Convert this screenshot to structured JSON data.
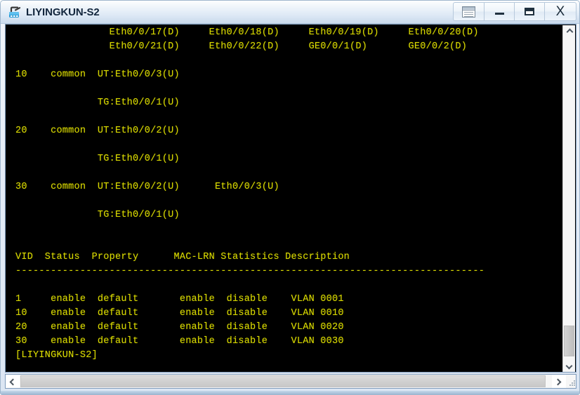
{
  "window": {
    "title": "LIYINGKUN-S2",
    "app_icon": "router-terminal-icon",
    "controls": {
      "restore_doc_label": "",
      "minimize_label": "",
      "maximize_label": "",
      "close_label": "X"
    }
  },
  "terminal": {
    "foreground_color": "#d7d700",
    "background_color": "#000000",
    "lines": [
      "                Eth0/0/17(D)     Eth0/0/18(D)     Eth0/0/19(D)     Eth0/0/20(D)",
      "                Eth0/0/21(D)     Eth0/0/22(D)     GE0/0/1(D)       GE0/0/2(D)",
      "",
      "10    common  UT:Eth0/0/3(U)",
      "",
      "              TG:Eth0/0/1(U)",
      "",
      "20    common  UT:Eth0/0/2(U)",
      "",
      "              TG:Eth0/0/1(U)",
      "",
      "30    common  UT:Eth0/0/2(U)      Eth0/0/3(U)",
      "",
      "              TG:Eth0/0/1(U)",
      "",
      "",
      "VID  Status  Property      MAC-LRN Statistics Description",
      "--------------------------------------------------------------------------------",
      "",
      "1     enable  default       enable  disable    VLAN 0001",
      "10    enable  default       enable  disable    VLAN 0010",
      "20    enable  default       enable  disable    VLAN 0020",
      "30    enable  default       enable  disable    VLAN 0030",
      "[LIYINGKUN-S2]"
    ],
    "vlan_table": {
      "headers": [
        "VID",
        "Status",
        "Property",
        "MAC-LRN",
        "Statistics",
        "Description"
      ],
      "rows": [
        [
          "1",
          "enable",
          "default",
          "enable",
          "disable",
          "VLAN 0001"
        ],
        [
          "10",
          "enable",
          "default",
          "enable",
          "disable",
          "VLAN 0010"
        ],
        [
          "20",
          "enable",
          "default",
          "enable",
          "disable",
          "VLAN 0020"
        ],
        [
          "30",
          "enable",
          "default",
          "enable",
          "disable",
          "VLAN 0030"
        ]
      ]
    },
    "port_list": {
      "down_ports": [
        "Eth0/0/17(D)",
        "Eth0/0/18(D)",
        "Eth0/0/19(D)",
        "Eth0/0/20(D)",
        "Eth0/0/21(D)",
        "Eth0/0/22(D)",
        "GE0/0/1(D)",
        "GE0/0/2(D)"
      ]
    },
    "vlan_members": [
      {
        "vid": "10",
        "type": "common",
        "untagged": "UT:Eth0/0/3(U)",
        "tagged": "TG:Eth0/0/1(U)"
      },
      {
        "vid": "20",
        "type": "common",
        "untagged": "UT:Eth0/0/2(U)",
        "tagged": "TG:Eth0/0/1(U)"
      },
      {
        "vid": "30",
        "type": "common",
        "untagged": "UT:Eth0/0/2(U)      Eth0/0/3(U)",
        "tagged": "TG:Eth0/0/1(U)"
      }
    ],
    "prompt": "[LIYINGKUN-S2]"
  },
  "scrollbars": {
    "vertical": {
      "up_arrow": "chevron-up",
      "down_arrow": "chevron-down"
    },
    "horizontal": {
      "left_arrow": "chevron-left",
      "right_arrow": "chevron-right"
    }
  }
}
